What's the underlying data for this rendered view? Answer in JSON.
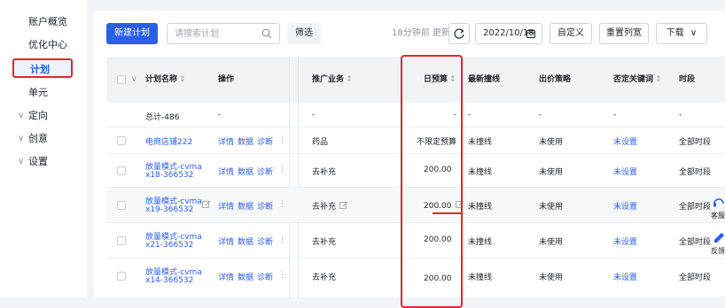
{
  "sidebar": {
    "items": [
      {
        "label": "账户概览",
        "active": false,
        "expand": false
      },
      {
        "label": "优化中心",
        "active": false,
        "expand": false
      },
      {
        "label": "计划",
        "active": true,
        "expand": false
      },
      {
        "label": "单元",
        "active": false,
        "expand": false
      },
      {
        "label": "定向",
        "active": false,
        "expand": true
      },
      {
        "label": "创意",
        "active": false,
        "expand": true
      },
      {
        "label": "设置",
        "active": false,
        "expand": true
      }
    ]
  },
  "toolbar": {
    "new_plan": "新建计划",
    "search_placeholder": "请搜索计划",
    "filter": "筛选",
    "updated": "18分钟前 更新",
    "date": "2022/10/18",
    "custom": "自定义",
    "reset_width": "重置列宽",
    "download": "下载"
  },
  "table": {
    "headers": {
      "name": "计划名称",
      "ops": "操作",
      "business": "推广业务",
      "budget": "日预算",
      "bid_line": "最新撞线",
      "bid_strategy": "出价策略",
      "negative_kw": "否定关键词",
      "time": "时段"
    },
    "summary": {
      "name": "总计-486",
      "ops": "-",
      "business": "-",
      "budget": "-",
      "bid_line": "-",
      "bid_strategy": "-",
      "negative_kw": "-",
      "time": "-"
    },
    "rows": [
      {
        "name_line1": "电商店铺222",
        "name_line2": "",
        "ops": [
          "详情",
          "数据",
          "诊断"
        ],
        "business": "药品",
        "budget": "不限定预算",
        "bid_line": "未撞线",
        "bid_strategy": "未使用",
        "negative_kw": "未设置",
        "time": "全部时段"
      },
      {
        "name_line1": "放量模式-cvma",
        "name_line2": "x18-366532",
        "ops": [
          "详情",
          "数据",
          "诊断"
        ],
        "business": "去补充",
        "budget": "200.00",
        "bid_line": "未撞线",
        "bid_strategy": "未使用",
        "negative_kw": "未设置",
        "time": "全部时段"
      },
      {
        "name_line1": "放量模式-cvma",
        "name_line2": "x19-366532",
        "ops": [
          "详情",
          "数据",
          "诊断"
        ],
        "business": "去补充",
        "budget": "200.00",
        "bid_line": "未撞线",
        "bid_strategy": "未使用",
        "negative_kw": "未设置",
        "time": "全部时段"
      },
      {
        "name_line1": "放量模式-cvma",
        "name_line2": "x21-366532",
        "ops": [
          "详情",
          "数据",
          "诊断"
        ],
        "business": "去补充",
        "budget": "200.00",
        "bid_line": "未撞线",
        "bid_strategy": "未使用",
        "negative_kw": "未设置",
        "time": "全部时段"
      },
      {
        "name_line1": "放量模式-cvma",
        "name_line2": "x14-366532",
        "ops": [
          "详情",
          "数据",
          "诊断"
        ],
        "business": "去补充",
        "budget": "200.00",
        "bid_line": "未撞线",
        "bid_strategy": "未使用",
        "negative_kw": "未设置",
        "time": "全部时段"
      }
    ]
  },
  "float_tools": {
    "service": "客服",
    "feedback": "反馈"
  },
  "colors": {
    "primary": "#2c5ee8",
    "highlight": "#e3262c"
  }
}
